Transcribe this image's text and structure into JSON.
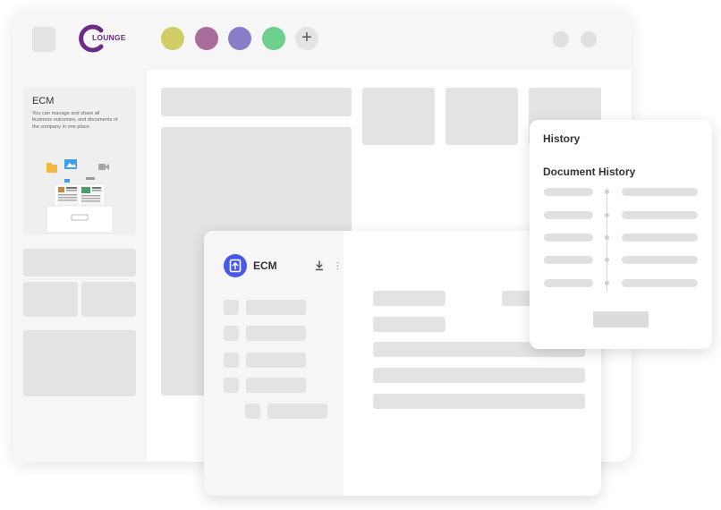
{
  "app": {
    "logo_letter": "C",
    "logo_text": "LOUNGE",
    "logo_color": "#6b2c85"
  },
  "toolbar": {
    "app_dots": [
      {
        "name": "app-dot-olive",
        "color": "#cfcd63"
      },
      {
        "name": "app-dot-mauve",
        "color": "#a86d9b"
      },
      {
        "name": "app-dot-violet",
        "color": "#8a7dc8"
      },
      {
        "name": "app-dot-green",
        "color": "#6dd08e"
      }
    ],
    "add_label": "+"
  },
  "sidebar": {
    "card_title": "ECM",
    "card_description": "You can manage and share all business outcomes, and documents of the company in one place."
  },
  "ecm_panel": {
    "title": "ECM",
    "accent": "#4a58e8",
    "download_icon": "download-icon",
    "more_icon": "more-vertical-icon"
  },
  "history_panel": {
    "title": "History",
    "subtitle": "Document History"
  }
}
